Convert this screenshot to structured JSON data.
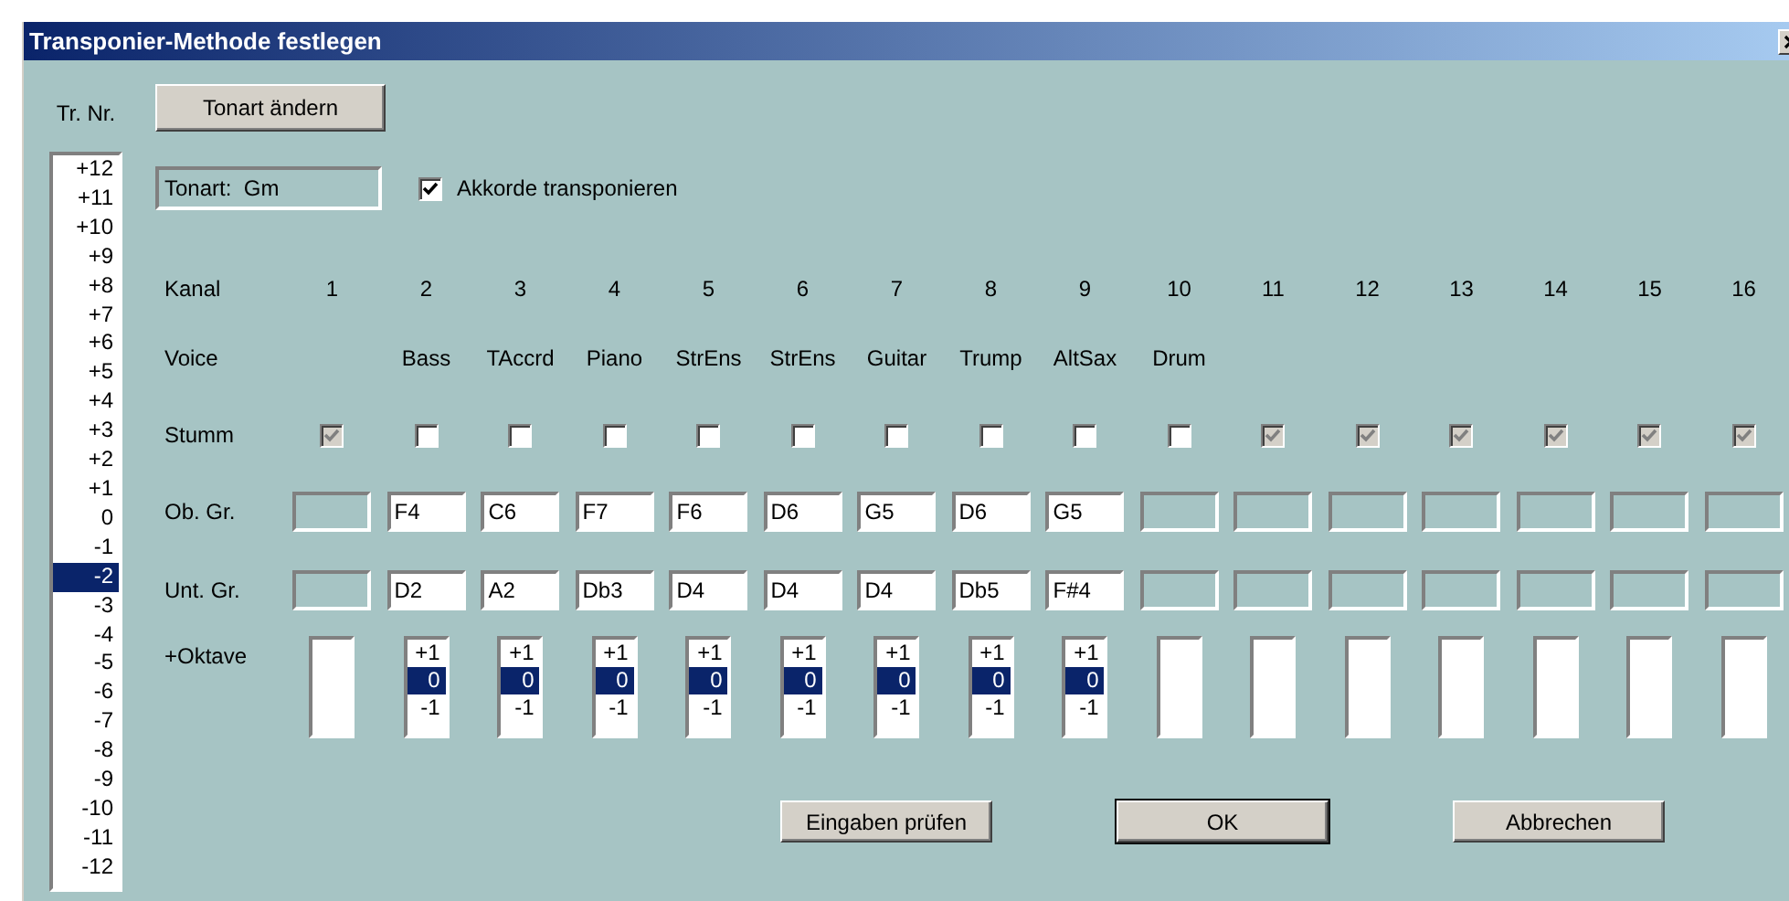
{
  "window": {
    "title": "Transponier-Methode festlegen"
  },
  "transpose_list": {
    "label": "Tr. Nr.",
    "items": [
      {
        "text": "+12",
        "selected": false
      },
      {
        "text": "+11",
        "selected": false
      },
      {
        "text": "+10",
        "selected": false
      },
      {
        "text": "+9",
        "selected": false
      },
      {
        "text": "+8",
        "selected": false
      },
      {
        "text": "+7",
        "selected": false
      },
      {
        "text": "+6",
        "selected": false
      },
      {
        "text": "+5",
        "selected": false
      },
      {
        "text": "+4",
        "selected": false
      },
      {
        "text": "+3",
        "selected": false
      },
      {
        "text": "+2",
        "selected": false
      },
      {
        "text": "+1",
        "selected": false
      },
      {
        "text": "0",
        "selected": false
      },
      {
        "text": "-1",
        "selected": false
      },
      {
        "text": "-2",
        "selected": true
      },
      {
        "text": "-3",
        "selected": false
      },
      {
        "text": "-4",
        "selected": false
      },
      {
        "text": "-5",
        "selected": false
      },
      {
        "text": "-6",
        "selected": false
      },
      {
        "text": "-7",
        "selected": false
      },
      {
        "text": "-8",
        "selected": false
      },
      {
        "text": "-9",
        "selected": false
      },
      {
        "text": "-10",
        "selected": false
      },
      {
        "text": "-11",
        "selected": false
      },
      {
        "text": "-12",
        "selected": false
      }
    ]
  },
  "key_button": "Tonart ändern",
  "key_display": "Tonart:  Gm",
  "chords_checkbox": {
    "label": "Akkorde transponieren",
    "checked": true
  },
  "row_labels": {
    "channel": "Kanal",
    "voice": "Voice",
    "mute": "Stumm",
    "upper": "Ob. Gr.",
    "lower": "Unt. Gr.",
    "octave": "+Oktave"
  },
  "channels": [
    {
      "number": "1",
      "active": false,
      "mute": {
        "checked": true,
        "disabled": true
      }
    },
    {
      "number": "2",
      "voice": "Bass",
      "active": true,
      "mute": {
        "checked": false,
        "disabled": false
      },
      "upper": "F4",
      "lower": "D2",
      "octave": [
        {
          "text": "+1",
          "selected": false
        },
        {
          "text": "0",
          "selected": true
        },
        {
          "text": "-1",
          "selected": false
        }
      ]
    },
    {
      "number": "3",
      "voice": "TAccrd",
      "active": true,
      "mute": {
        "checked": false,
        "disabled": false
      },
      "upper": "C6",
      "lower": "A2",
      "octave": [
        {
          "text": "+1",
          "selected": false
        },
        {
          "text": "0",
          "selected": true
        },
        {
          "text": "-1",
          "selected": false
        }
      ]
    },
    {
      "number": "4",
      "voice": "Piano",
      "active": true,
      "mute": {
        "checked": false,
        "disabled": false
      },
      "upper": "F7",
      "lower": "Db3",
      "octave": [
        {
          "text": "+1",
          "selected": false
        },
        {
          "text": "0",
          "selected": true
        },
        {
          "text": "-1",
          "selected": false
        }
      ]
    },
    {
      "number": "5",
      "voice": "StrEns",
      "active": true,
      "mute": {
        "checked": false,
        "disabled": false
      },
      "upper": "F6",
      "lower": "D4",
      "octave": [
        {
          "text": "+1",
          "selected": false
        },
        {
          "text": "0",
          "selected": true
        },
        {
          "text": "-1",
          "selected": false
        }
      ]
    },
    {
      "number": "6",
      "voice": "StrEns",
      "active": true,
      "mute": {
        "checked": false,
        "disabled": false
      },
      "upper": "D6",
      "lower": "D4",
      "octave": [
        {
          "text": "+1",
          "selected": false
        },
        {
          "text": "0",
          "selected": true
        },
        {
          "text": "-1",
          "selected": false
        }
      ]
    },
    {
      "number": "7",
      "voice": "Guitar",
      "active": true,
      "mute": {
        "checked": false,
        "disabled": false
      },
      "upper": "G5",
      "lower": "D4",
      "octave": [
        {
          "text": "+1",
          "selected": false
        },
        {
          "text": "0",
          "selected": true
        },
        {
          "text": "-1",
          "selected": false
        }
      ]
    },
    {
      "number": "8",
      "voice": "Trump",
      "active": true,
      "mute": {
        "checked": false,
        "disabled": false
      },
      "upper": "D6",
      "lower": "Db5",
      "octave": [
        {
          "text": "+1",
          "selected": false
        },
        {
          "text": "0",
          "selected": true
        },
        {
          "text": "-1",
          "selected": false
        }
      ]
    },
    {
      "number": "9",
      "voice": "AltSax",
      "active": true,
      "mute": {
        "checked": false,
        "disabled": false
      },
      "upper": "G5",
      "lower": "F#4",
      "octave": [
        {
          "text": "+1",
          "selected": false
        },
        {
          "text": "0",
          "selected": true
        },
        {
          "text": "-1",
          "selected": false
        }
      ]
    },
    {
      "number": "10",
      "voice": "Drum",
      "active": false,
      "mute": {
        "checked": false,
        "disabled": false
      }
    },
    {
      "number": "11",
      "active": false,
      "mute": {
        "checked": true,
        "disabled": true
      }
    },
    {
      "number": "12",
      "active": false,
      "mute": {
        "checked": true,
        "disabled": true
      }
    },
    {
      "number": "13",
      "active": false,
      "mute": {
        "checked": true,
        "disabled": true
      }
    },
    {
      "number": "14",
      "active": false,
      "mute": {
        "checked": true,
        "disabled": true
      }
    },
    {
      "number": "15",
      "active": false,
      "mute": {
        "checked": true,
        "disabled": true
      }
    },
    {
      "number": "16",
      "active": false,
      "mute": {
        "checked": true,
        "disabled": true
      }
    }
  ],
  "buttons": [
    {
      "label": "Eingaben prüfen",
      "default": false
    },
    {
      "label": "OK",
      "default": true
    },
    {
      "label": "Abbrechen",
      "default": false
    }
  ]
}
